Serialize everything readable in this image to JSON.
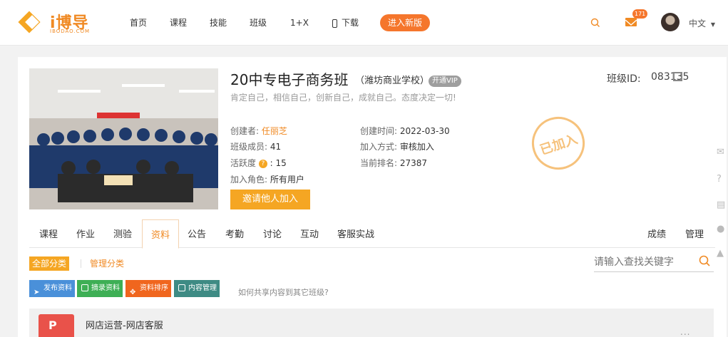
{
  "header": {
    "logo_text": "i博导",
    "logo_sub": "IBODAO.COM",
    "nav": [
      "首页",
      "课程",
      "技能",
      "班级",
      "1+X",
      "下载"
    ],
    "cta": "进入新版",
    "mail_count": "171",
    "lang": "中文",
    "colors": {
      "brand": "#f08a24",
      "cta": "#f5762c"
    }
  },
  "class": {
    "title": "20中专电子商务班",
    "school": "（潍坊商业学校）",
    "vip": "开通VIP",
    "motto": "肯定自己，相信自己，创新自己，成就自己。态度决定一切!",
    "id_label": "班级ID:",
    "id_value": "083135",
    "creator_label": "创建者:",
    "creator": "任丽芝",
    "created_label": "创建时间:",
    "created": "2022-03-30",
    "members_label": "班级成员:",
    "members": "41",
    "join_label": "加入方式:",
    "join": "审核加入",
    "activity_label": "活跃度",
    "activity_sep": ":",
    "activity": "15",
    "rank_label": "当前排名:",
    "rank": "27387",
    "role_label": "加入角色:",
    "role": "所有用户",
    "invite": "邀请他人加入",
    "stamp": "已加入"
  },
  "tabs": {
    "left": [
      "课程",
      "作业",
      "测验",
      "资料",
      "公告",
      "考勤",
      "讨论",
      "互动",
      "客服实战"
    ],
    "right": [
      "成绩",
      "管理"
    ],
    "active": "资料"
  },
  "resources": {
    "all_category": "全部分类",
    "manage_category": "管理分类",
    "search_placeholder": "请输入查找关键字",
    "actions": [
      {
        "label": "发布资料",
        "color": "#4a90d9"
      },
      {
        "label": "摘录资料",
        "color": "#3eaf55"
      },
      {
        "label": "资料排序",
        "color": "#f0661e"
      },
      {
        "label": "内容管理",
        "color": "#3e8b84"
      }
    ],
    "share_question": "如何共享内容到其它班级?",
    "file_name": "网店运营-网店客服",
    "file_more": "..."
  }
}
